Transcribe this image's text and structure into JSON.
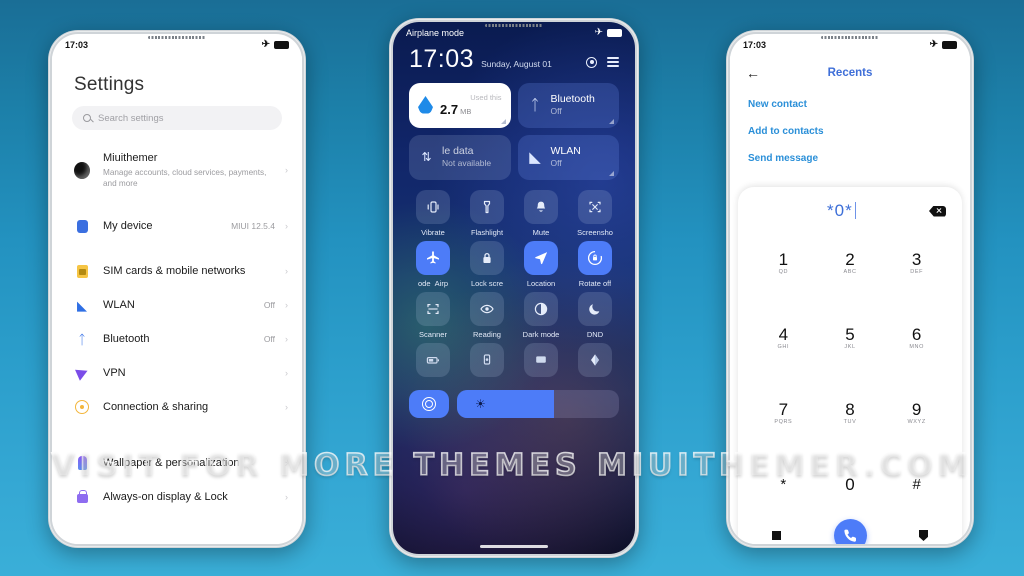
{
  "watermark": {
    "text": "VISIT FOR MORE THEMES  MIUITHEMER.COM"
  },
  "colors": {
    "background_top": "#1a6e96",
    "background_bottom": "#3aafd8",
    "accent_blue": "#4d7cf8",
    "dialer_title_blue": "#3f6fd8",
    "dialer_link_blue": "#2a8fd8"
  },
  "phone_left": {
    "status_bar": {
      "time": "17:03",
      "airplane_icon": "airplane-icon",
      "battery_icon": "battery-icon"
    },
    "title": "Settings",
    "search": {
      "placeholder": "Search settings",
      "icon": "search-icon"
    },
    "items": [
      {
        "label": "Miuithemer",
        "sublabel": "Manage accounts, cloud services, payments, and more",
        "value": "",
        "icon": "account-avatar"
      },
      {
        "label": "My device",
        "sublabel": "",
        "value": "MIUI 12.5.4",
        "icon": "device-icon"
      },
      {
        "label": "SIM cards & mobile networks",
        "sublabel": "",
        "value": "",
        "icon": "sim-card-icon"
      },
      {
        "label": "WLAN",
        "sublabel": "",
        "value": "Off",
        "icon": "wifi-icon"
      },
      {
        "label": "Bluetooth",
        "sublabel": "",
        "value": "Off",
        "icon": "bluetooth-icon"
      },
      {
        "label": "VPN",
        "sublabel": "",
        "value": "",
        "icon": "vpn-icon"
      },
      {
        "label": "Connection & sharing",
        "sublabel": "",
        "value": "",
        "icon": "connection-sharing-icon"
      },
      {
        "label": "Wallpaper & personalization",
        "sublabel": "",
        "value": "",
        "icon": "wallpaper-icon"
      },
      {
        "label": "Always-on display & Lock",
        "sublabel": "",
        "value": "",
        "icon": "lock-icon"
      }
    ],
    "chevron": "›"
  },
  "phone_center": {
    "status_bar": {
      "label": "Airplane mode",
      "airplane_icon": "airplane-icon",
      "battery_icon": "battery-icon"
    },
    "clock": {
      "time": "17:03",
      "date": "Sunday, August 01"
    },
    "header_icons": [
      "settings-gear-icon",
      "edit-menu-icon"
    ],
    "big_tiles": [
      {
        "name": "data-usage",
        "top_label": "Used this",
        "value": "2.7",
        "unit": "MB",
        "state": "on",
        "icon": "water-drop-icon"
      },
      {
        "name": "bluetooth",
        "title": "Bluetooth",
        "status": "Off",
        "state": "tint",
        "icon": "bluetooth-icon"
      },
      {
        "name": "mobile-data",
        "title": "le data",
        "status": "Not available",
        "state": "off",
        "icon": "data-transfer-icon"
      },
      {
        "name": "wlan",
        "title": "WLAN",
        "status": "Off",
        "state": "tint",
        "icon": "wifi-icon"
      }
    ],
    "toggles": [
      {
        "label": "Vibrate",
        "icon": "vibrate-icon",
        "state": "off"
      },
      {
        "label": "Flashlight",
        "icon": "flashlight-icon",
        "state": "off"
      },
      {
        "label": "Mute",
        "icon": "bell-icon",
        "state": "off"
      },
      {
        "label": "Screensho",
        "icon": "screenshot-icon",
        "state": "off"
      },
      {
        "label": "Airp",
        "prefix": "ode",
        "icon": "airplane-icon",
        "state": "on"
      },
      {
        "label": "Lock scre",
        "icon": "padlock-icon",
        "state": "off"
      },
      {
        "label": "Location",
        "icon": "location-arrow-icon",
        "state": "on"
      },
      {
        "label": "Rotate off",
        "icon": "rotate-lock-icon",
        "state": "on"
      },
      {
        "label": "Scanner",
        "icon": "scanner-icon",
        "state": "off"
      },
      {
        "label": "Reading",
        "icon": "eye-icon",
        "state": "off"
      },
      {
        "label": "Dark mode",
        "icon": "contrast-icon",
        "state": "off"
      },
      {
        "label": "DND",
        "icon": "moon-icon",
        "state": "off"
      },
      {
        "label": "",
        "icon": "battery-saver-icon",
        "state": "off"
      },
      {
        "label": "",
        "icon": "cast-icon",
        "state": "off"
      },
      {
        "label": "",
        "icon": "screen-icon",
        "state": "off"
      },
      {
        "label": "",
        "icon": "theme-icon",
        "state": "off"
      }
    ],
    "bottom": {
      "settings_icon": "control-ring-icon",
      "brightness_icon": "brightness-sun-icon",
      "brightness_percent": 60
    }
  },
  "phone_right": {
    "status_bar": {
      "time": "17:03",
      "airplane_icon": "airplane-icon",
      "battery_icon": "battery-icon"
    },
    "header": {
      "back_icon": "back-arrow-icon",
      "title": "Recents"
    },
    "links": [
      "New contact",
      "Add to contacts",
      "Send message"
    ],
    "dialpad": {
      "entered_number": "*0*",
      "backspace_icon": "backspace-icon",
      "keys": [
        {
          "digit": "1",
          "letters": "QD"
        },
        {
          "digit": "2",
          "letters": "ABC"
        },
        {
          "digit": "3",
          "letters": "DEF"
        },
        {
          "digit": "4",
          "letters": "GHI"
        },
        {
          "digit": "5",
          "letters": "JKL"
        },
        {
          "digit": "6",
          "letters": "MNO"
        },
        {
          "digit": "7",
          "letters": "PQRS"
        },
        {
          "digit": "8",
          "letters": "TUV"
        },
        {
          "digit": "9",
          "letters": "WXYZ"
        },
        {
          "digit": "*",
          "letters": ""
        },
        {
          "digit": "0",
          "letters": ""
        },
        {
          "digit": "#",
          "letters": ""
        }
      ],
      "call_icon": "phone-call-icon",
      "left_icon": "recent-square-icon",
      "right_icon": "contacts-shield-icon"
    }
  }
}
